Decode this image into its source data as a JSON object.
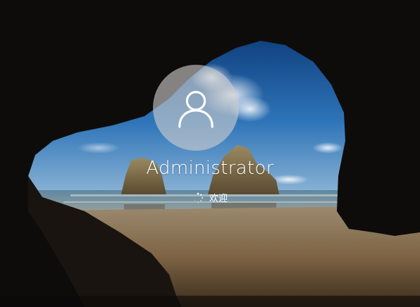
{
  "user": {
    "name": "Administrator",
    "avatar_icon": "user-silhouette-icon"
  },
  "status": {
    "text": "欢迎",
    "spinner_icon": "loading-spinner-icon"
  },
  "background": {
    "description_icon": "sea-cave-wallpaper"
  }
}
